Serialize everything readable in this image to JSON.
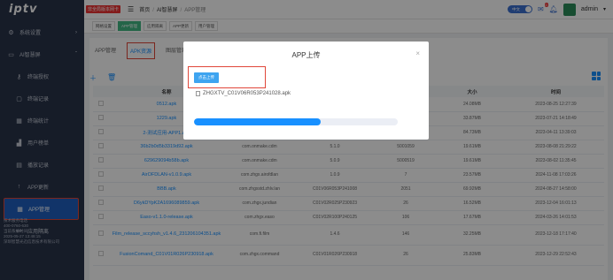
{
  "brand": {
    "logo": "iptv"
  },
  "sidebar": {
    "items": [
      {
        "label": "系统设置",
        "type": "group",
        "icon": "gear-icon"
      },
      {
        "label": "AI智慧屏",
        "type": "group",
        "icon": "monitor-icon",
        "expanded": true
      },
      {
        "label": "终端授权",
        "type": "item",
        "icon": "key-icon"
      },
      {
        "label": "终端记录",
        "type": "item",
        "icon": "doc-icon"
      },
      {
        "label": "终端统计",
        "type": "item",
        "icon": "calendar-icon"
      },
      {
        "label": "用户榜单",
        "type": "item",
        "icon": "chart-icon"
      },
      {
        "label": "播放记录",
        "type": "item",
        "icon": "log-icon"
      },
      {
        "label": "APP更新",
        "type": "item",
        "icon": "upload-icon"
      },
      {
        "label": "APP管理",
        "type": "item",
        "icon": "grid-icon",
        "active": true
      },
      {
        "label": "应用隔离",
        "type": "item",
        "icon": "split-icon"
      }
    ],
    "footer": [
      "技术服务电话",
      "400-0760-630",
      "当前系统时间",
      "2025-05-27 13:48:15",
      "深圳智慧光迅信息技术有限公司"
    ]
  },
  "topbar": {
    "red_badge": "非全局版本网卡",
    "breadcrumb": [
      "首页",
      "AI智慧屏",
      "APP管理"
    ],
    "toggle_label": "中文",
    "notify_count": "0",
    "user": "admin"
  },
  "tags": [
    "网格设置",
    "APP管理",
    "应用隔离",
    "APP更新",
    "用户管理"
  ],
  "tags_active": 1,
  "subtabs": [
    "APP管理",
    "APK资源",
    "图层管理"
  ],
  "subtabs_active": 1,
  "table": {
    "headers": [
      "",
      "名称",
      "",
      "",
      "",
      "大小",
      "时间"
    ],
    "rows": [
      {
        "name": "0512.apk",
        "c3": "",
        "c4": "",
        "c5": "",
        "size": "24.08MB",
        "time": "2023-08-25 12:27:39"
      },
      {
        "name": "1229.apk",
        "c3": "",
        "c4": "",
        "c5": "",
        "size": "33.87MB",
        "time": "2023-07-21 14:18:49"
      },
      {
        "name": "2-测试应用-APP1.apk",
        "c3": "com.x.ahh",
        "c4": "1.4.6",
        "c5": "146",
        "size": "84.73MB",
        "time": "2023-04-11 13:39:03"
      },
      {
        "name": "36b2b0d5b3319d92.apk",
        "c3": "com.onmake.cdm",
        "c4": "5.1.0",
        "c5": "5001059",
        "size": "19.61MB",
        "time": "2023-08-08 21:29:22"
      },
      {
        "name": "629629094b58b.apk",
        "c3": "com.onmake.cdm",
        "c4": "5.0.9",
        "c5": "5000519",
        "size": "19.61MB",
        "time": "2023-08-02 11:35:45"
      },
      {
        "name": "AirOFDLAN-v1.0.9.apk",
        "c3": "com.zhgx.airofdlan",
        "c4": "1.0.9",
        "c5": "7",
        "size": "23.57MB",
        "time": "2024-11-08 17:03:26"
      },
      {
        "name": "BBB.apk",
        "c3": "com.zhgxstd.zhlv.lan",
        "c4": "C01V06R053P241008",
        "c5": "2051",
        "size": "69.92MB",
        "time": "2024-08-27 14:58:00"
      },
      {
        "name": "D6ykDYpK2A1696089859.apk",
        "c3": "com.zhgx.jundian",
        "c4": "C01V02R025P230923",
        "c5": "26",
        "size": "16.52MB",
        "time": "2023-12-04 16:01:13"
      },
      {
        "name": "Easo-v1.1.0-release.apk",
        "c3": "com.zhgx.easo",
        "c4": "C01V02R100P240125",
        "c5": "106",
        "size": "17.67MB",
        "time": "2024-03-26 14:01:53"
      },
      {
        "name": "Film_release_sccyhsh_v1.4.6_231206104351.apk",
        "c3": "com.fi.film",
        "c4": "1.4.6",
        "c5": "146",
        "size": "32.25MB",
        "time": "2023-12-18 17:17:40"
      },
      {
        "name": "FusionComand_C01V01R026P230918.apk",
        "c3": "com.zhgx.command",
        "c4": "C01V01R026P230918",
        "c5": "26",
        "size": "25.83MB",
        "time": "2023-12-29 22:52:43"
      }
    ]
  },
  "modal": {
    "title": "APP上传",
    "upload_button": "点击上传",
    "file_name": "ZHGXTV_C01V06R053P241028.apk",
    "progress": 0.62,
    "progress_text": ""
  },
  "colors": {
    "sidebar_bg": "#28334a",
    "accent": "#1890ff",
    "active_tag": "#42b983",
    "highlight_border": "#e0473a"
  }
}
